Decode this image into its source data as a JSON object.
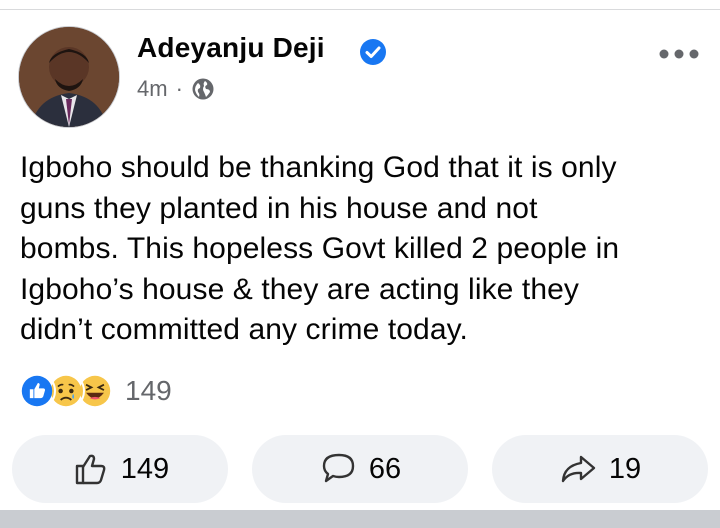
{
  "post": {
    "author": "Adeyanju Deji",
    "time": "4m",
    "separator": "·",
    "text": "Igboho should be thanking God that it is only\nguns they planted in his house and not\nbombs. This hopeless Govt killed 2 people in\nIgboho’s house & they are acting like they\ndidn’t committed any crime today.",
    "reactions": {
      "icons": [
        "like-reaction-icon",
        "sad-reaction-icon",
        "haha-reaction-icon"
      ],
      "count": "149"
    },
    "actions": {
      "like_count": "149",
      "comment_count": "66",
      "share_count": "19"
    }
  },
  "colors": {
    "verified": "#1877f2",
    "secondary_text": "#65676b",
    "action_bg": "#f0f2f5"
  }
}
